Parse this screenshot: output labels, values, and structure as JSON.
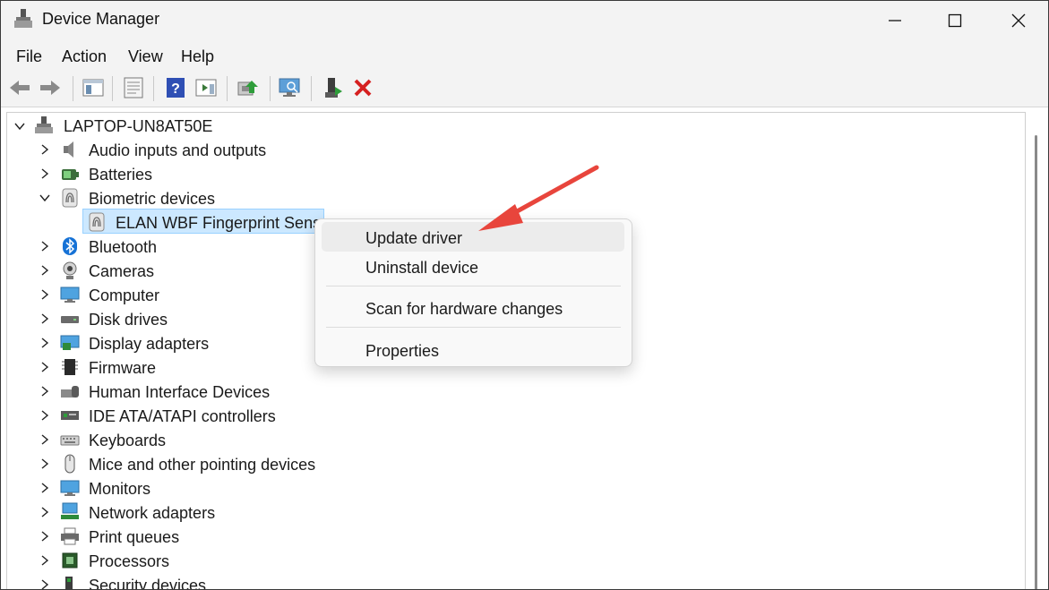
{
  "window": {
    "title": "Device Manager"
  },
  "menu": [
    "File",
    "Action",
    "View",
    "Help"
  ],
  "toolbar": {
    "icons": [
      "back-icon",
      "forward-icon",
      "show-hide-console-tree-icon",
      "properties-icon",
      "help-icon",
      "action-pane-icon",
      "update-driver-icon",
      "scan-hardware-icon",
      "enable-device-icon",
      "uninstall-icon"
    ]
  },
  "tree": {
    "root": "LAPTOP-UN8AT50E",
    "items": [
      {
        "label": "Audio inputs and outputs",
        "icon": "speaker-icon"
      },
      {
        "label": "Batteries",
        "icon": "battery-icon"
      },
      {
        "label": "Biometric devices",
        "icon": "fingerprint-icon",
        "expanded": true
      },
      {
        "label": "ELAN WBF Fingerprint Senso",
        "icon": "fingerprint-icon",
        "child": true,
        "selected": true
      },
      {
        "label": "Bluetooth",
        "icon": "bluetooth-icon"
      },
      {
        "label": "Cameras",
        "icon": "camera-icon"
      },
      {
        "label": "Computer",
        "icon": "computer-icon"
      },
      {
        "label": "Disk drives",
        "icon": "disk-icon"
      },
      {
        "label": "Display adapters",
        "icon": "display-adapter-icon"
      },
      {
        "label": "Firmware",
        "icon": "firmware-icon"
      },
      {
        "label": "Human Interface Devices",
        "icon": "hid-icon"
      },
      {
        "label": "IDE ATA/ATAPI controllers",
        "icon": "ide-controller-icon"
      },
      {
        "label": "Keyboards",
        "icon": "keyboard-icon"
      },
      {
        "label": "Mice and other pointing devices",
        "icon": "mouse-icon"
      },
      {
        "label": "Monitors",
        "icon": "monitor-icon"
      },
      {
        "label": "Network adapters",
        "icon": "network-icon"
      },
      {
        "label": "Print queues",
        "icon": "printer-icon"
      },
      {
        "label": "Processors",
        "icon": "processor-icon"
      },
      {
        "label": "Security devices",
        "icon": "security-icon"
      }
    ]
  },
  "context_menu": {
    "items": [
      "Update driver",
      "Uninstall device",
      "Scan for hardware changes",
      "Properties"
    ]
  },
  "colors": {
    "selection": "#cce8ff",
    "annotation_arrow": "#e8453c",
    "uninstall_x": "#d62020"
  }
}
